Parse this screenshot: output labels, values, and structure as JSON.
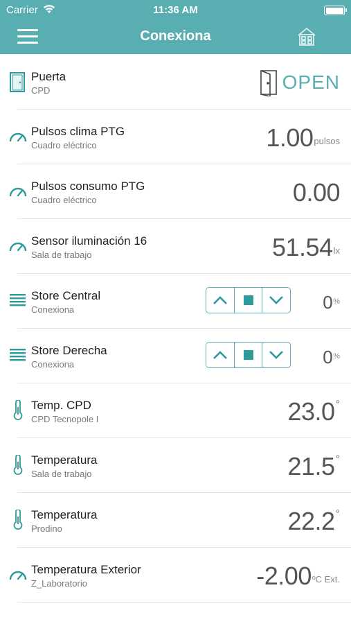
{
  "status_bar": {
    "carrier": "Carrier",
    "time": "11:36 AM"
  },
  "nav": {
    "title": "Conexiona"
  },
  "colors": {
    "accent": "#58aeb0",
    "icon": "#2f9a9c"
  },
  "rows": [
    {
      "title": "Puerta",
      "subtitle": "CPD",
      "icon": "door-icon",
      "state": "OPEN"
    },
    {
      "title": "Pulsos clima PTG",
      "subtitle": "Cuadro eléctrico",
      "icon": "gauge-icon",
      "value": "1.00",
      "unit": "pulsos"
    },
    {
      "title": "Pulsos consumo PTG",
      "subtitle": "Cuadro eléctrico",
      "icon": "gauge-icon",
      "value": "0.00",
      "unit": ""
    },
    {
      "title": "Sensor iluminación 16",
      "subtitle": "Sala de trabajo",
      "icon": "gauge-icon",
      "value": "51.54",
      "unit": "lx"
    },
    {
      "title": "Store Central",
      "subtitle": "Conexiona",
      "icon": "blinds-icon",
      "value": "0",
      "unit": "%"
    },
    {
      "title": "Store Derecha",
      "subtitle": "Conexiona",
      "icon": "blinds-icon",
      "value": "0",
      "unit": "%"
    },
    {
      "title": "Temp. CPD",
      "subtitle": "CPD Tecnopole I",
      "icon": "thermometer-icon",
      "value": "23.0",
      "unit": "°"
    },
    {
      "title": "Temperatura",
      "subtitle": "Sala de trabajo",
      "icon": "thermometer-icon",
      "value": "21.5",
      "unit": "°"
    },
    {
      "title": "Temperatura",
      "subtitle": "Prodino",
      "icon": "thermometer-icon",
      "value": "22.2",
      "unit": "°"
    },
    {
      "title": "Temperatura Exterior",
      "subtitle": "Z_Laboratorio",
      "icon": "gauge-icon",
      "value": "-2.00",
      "unit": "ºC Ext."
    }
  ]
}
